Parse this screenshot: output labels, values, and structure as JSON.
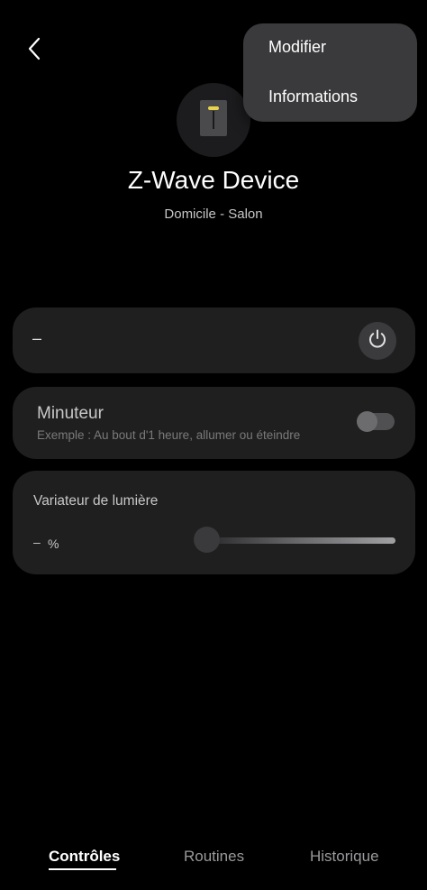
{
  "header": {
    "back_icon": "chevron-left-icon"
  },
  "menu": {
    "items": [
      {
        "label": "Modifier"
      },
      {
        "label": "Informations"
      }
    ]
  },
  "device": {
    "icon": "light-switch-icon",
    "name": "Z-Wave Device",
    "location": "Domicile - Salon",
    "accent_color": "#e8d44a"
  },
  "power_card": {
    "status": "–",
    "icon": "power-icon"
  },
  "timer_card": {
    "title": "Minuteur",
    "subtitle": "Exemple : Au bout d'1 heure, allumer ou éteindre",
    "enabled": false
  },
  "dimmer_card": {
    "title": "Variateur de lumière",
    "value": "–",
    "unit": "%"
  },
  "tabs": [
    {
      "label": "Contrôles",
      "active": true
    },
    {
      "label": "Routines",
      "active": false
    },
    {
      "label": "Historique",
      "active": false
    }
  ]
}
